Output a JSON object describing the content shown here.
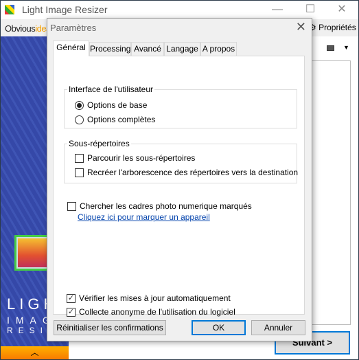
{
  "main_window": {
    "title": "Light Image Resizer",
    "logo_prefix": "Obvious",
    "logo_suffix": "idea",
    "properties_label": "⚙ Propriétés",
    "next_button": "Suivant >",
    "brand_lines": [
      "LIGHT",
      "IMAGE",
      "RESIZER"
    ],
    "collapse_icon": "chevron-up-icon",
    "accent": "#0078d7",
    "panel_color": "#3548a8",
    "orange": "#f79a00"
  },
  "dialog": {
    "title": "Paramètres",
    "tabs": [
      {
        "label": "Général",
        "active": true
      },
      {
        "label": "Processing"
      },
      {
        "label": "Avancé"
      },
      {
        "label": "Langage"
      },
      {
        "label": "A propos"
      }
    ],
    "ui_group": {
      "label": "Interface de l'utilisateur",
      "options": [
        {
          "label": "Options de base",
          "selected": true
        },
        {
          "label": "Options complètes",
          "selected": false
        }
      ]
    },
    "subdir_group": {
      "label": "Sous-répertoires",
      "options": [
        {
          "label": "Parcourir les sous-répertoires",
          "checked": false
        },
        {
          "label": "Recréer l'arborescence des répertoires vers la destination",
          "checked": false
        }
      ]
    },
    "frames": {
      "label": "Chercher les cadres photo numerique marqués",
      "checked": false,
      "link": "Cliquez ici pour marquer un appareil"
    },
    "updates": {
      "label": "Vérifier les mises à jour automatiquement",
      "checked": true
    },
    "telemetry": {
      "label": "Collecte anonyme de l'utilisation du logiciel",
      "checked": true
    },
    "buttons": {
      "reset": "Réinitialiser les confirmations",
      "ok": "OK",
      "cancel": "Annuler"
    }
  }
}
